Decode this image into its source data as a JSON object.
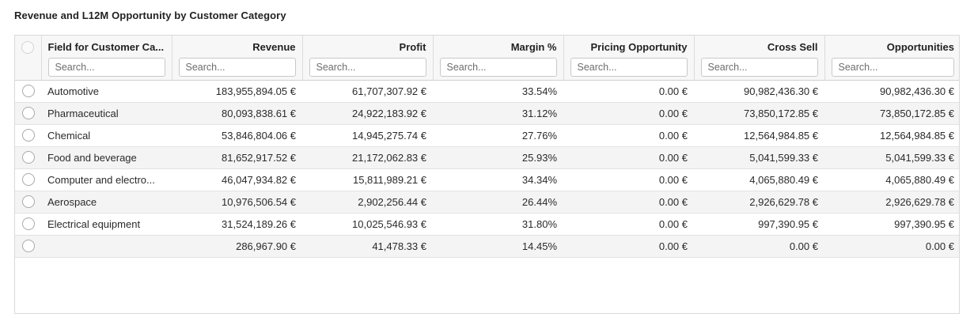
{
  "title": "Revenue and L12M Opportunity by Customer Category",
  "columns": [
    {
      "label": "Field for Customer Ca...",
      "placeholder": "Search..."
    },
    {
      "label": "Revenue",
      "placeholder": "Search..."
    },
    {
      "label": "Profit",
      "placeholder": "Search..."
    },
    {
      "label": "Margin %",
      "placeholder": "Search..."
    },
    {
      "label": "Pricing Opportunity",
      "placeholder": "Search..."
    },
    {
      "label": "Cross Sell",
      "placeholder": "Search..."
    },
    {
      "label": "Opportunities",
      "placeholder": "Search..."
    }
  ],
  "rows": [
    [
      "Automotive",
      "183,955,894.05 €",
      "61,707,307.92 €",
      "33.54%",
      "0.00 €",
      "90,982,436.30 €",
      "90,982,436.30 €"
    ],
    [
      "Pharmaceutical",
      "80,093,838.61 €",
      "24,922,183.92 €",
      "31.12%",
      "0.00 €",
      "73,850,172.85 €",
      "73,850,172.85 €"
    ],
    [
      "Chemical",
      "53,846,804.06 €",
      "14,945,275.74 €",
      "27.76%",
      "0.00 €",
      "12,564,984.85 €",
      "12,564,984.85 €"
    ],
    [
      "Food and beverage",
      "81,652,917.52 €",
      "21,172,062.83 €",
      "25.93%",
      "0.00 €",
      "5,041,599.33 €",
      "5,041,599.33 €"
    ],
    [
      "Computer and electro...",
      "46,047,934.82 €",
      "15,811,989.21 €",
      "34.34%",
      "0.00 €",
      "4,065,880.49 €",
      "4,065,880.49 €"
    ],
    [
      "Aerospace",
      "10,976,506.54 €",
      "2,902,256.44 €",
      "26.44%",
      "0.00 €",
      "2,926,629.78 €",
      "2,926,629.78 €"
    ],
    [
      "Electrical equipment",
      "31,524,189.26 €",
      "10,025,546.93 €",
      "31.80%",
      "0.00 €",
      "997,390.95 €",
      "997,390.95 €"
    ],
    [
      "",
      "286,967.90 €",
      "41,478.33 €",
      "14.45%",
      "0.00 €",
      "0.00 €",
      "0.00 €"
    ]
  ]
}
